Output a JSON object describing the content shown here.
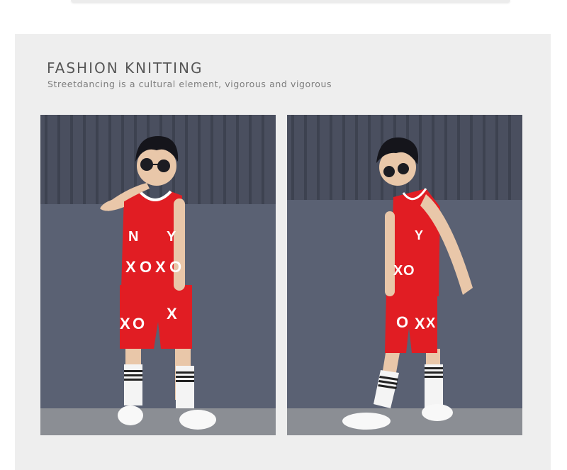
{
  "header": {
    "title": "FASHION KNITTING",
    "subtitle": "Streetdancing is a cultural element, vigorous and vigorous"
  },
  "photos": [
    {
      "name": "front-view",
      "top_letters": [
        "N",
        "Y"
      ],
      "mid_letters": [
        "X",
        "O",
        "X",
        "O"
      ],
      "short_letters": [
        "X",
        "O",
        "X"
      ]
    },
    {
      "name": "side-view",
      "top_letters": [
        "Y"
      ],
      "mid_letters": [
        "X",
        "O"
      ],
      "short_letters": [
        "O",
        "X",
        "X"
      ]
    }
  ],
  "colors": {
    "card_background": "#eeeeee",
    "wall_panel": "#4e5466",
    "wall_lower": "#5c6476",
    "floor": "#8a8d93",
    "outfit_red": "#e11d23",
    "socks_white": "#f4f4f4"
  }
}
